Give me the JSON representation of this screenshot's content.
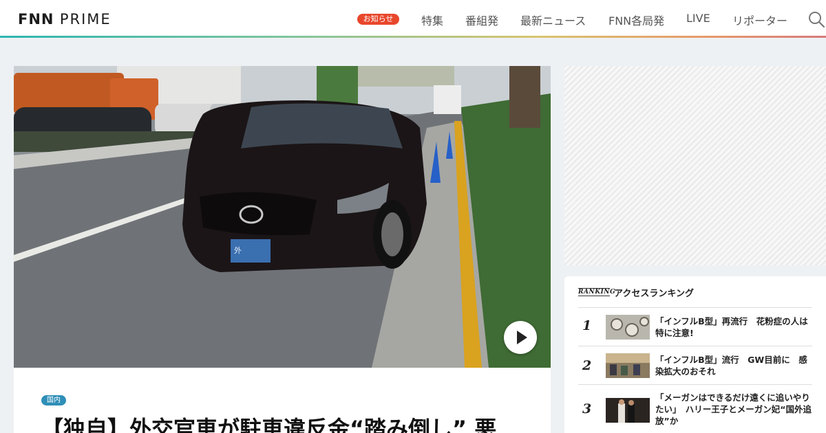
{
  "header": {
    "logo_main": "FNN",
    "logo_sub": "PRIME",
    "notice_label": "お知らせ",
    "nav": [
      "特集",
      "番組発",
      "最新ニュース",
      "FNN各局発",
      "LIVE",
      "リポーター"
    ],
    "search_icon": "search-icon"
  },
  "hero": {
    "plate_text": "外",
    "play_icon": "play-icon"
  },
  "article": {
    "category": "国内",
    "headline": "【独自】外交官車が駐車違反金“踏み倒し” 悪"
  },
  "ranking": {
    "logo": "RANKING",
    "title": "アクセスランキング",
    "items": [
      {
        "rank": "1",
        "text": "「インフルB型」再流行　花粉症の人は特に注意!"
      },
      {
        "rank": "2",
        "text": "「インフルB型」流行　GW目前に　感染拡大のおそれ"
      },
      {
        "rank": "3",
        "text": "「メーガンはできるだけ遠くに追いやりたい」　ハリー王子とメーガン妃“国外追放”か"
      }
    ]
  },
  "colors": {
    "notice_bg": "#e8472c",
    "category_bg": "#2f8fb8",
    "page_bg": "#eef1f4"
  }
}
